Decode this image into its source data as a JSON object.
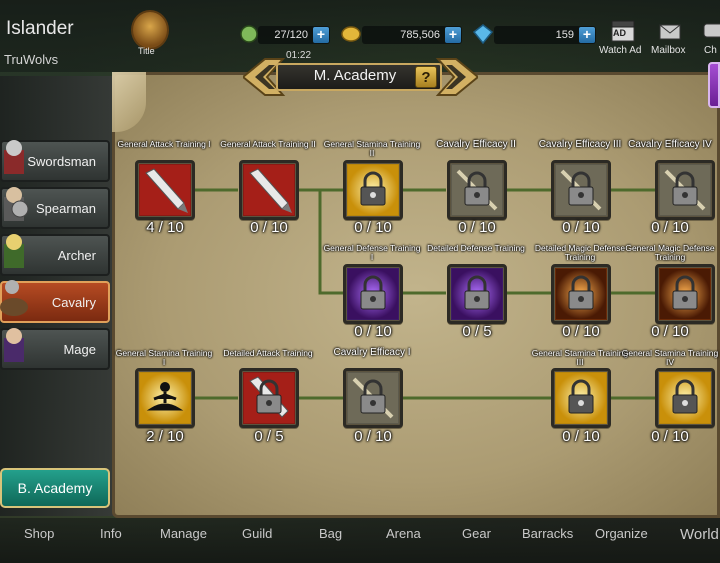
{
  "player": {
    "name": "Islander",
    "guild": "TruWolvs",
    "title_label": "Title"
  },
  "resources": [
    {
      "name": "stamina",
      "value": "27/120",
      "icon": "stamina-icon"
    },
    {
      "name": "gold",
      "value": "785,506",
      "icon": "coin-icon"
    },
    {
      "name": "gems",
      "value": "159",
      "icon": "gem-icon"
    }
  ],
  "timer": "01:22",
  "top_buttons": {
    "watch_ad": "Watch Ad",
    "watch_ad_icon_text": "AD",
    "mailbox": "Mailbox",
    "chat": "Ch"
  },
  "panel": {
    "title": "M. Academy",
    "help": "?"
  },
  "classes": [
    {
      "label": "Swordsman",
      "active": false
    },
    {
      "label": "Spearman",
      "active": false
    },
    {
      "label": "Archer",
      "active": false
    },
    {
      "label": "Cavalry",
      "active": true
    },
    {
      "label": "Mage",
      "active": false
    }
  ],
  "b_academy": "B. Academy",
  "nodes": [
    {
      "id": "n1",
      "title": "General Attack Training I",
      "level": "4 / 10",
      "icon": "sword-icon",
      "locked": false
    },
    {
      "id": "n2",
      "title": "General Attack Training II",
      "level": "0 / 10",
      "icon": "sword-icon",
      "locked": false
    },
    {
      "id": "n3",
      "title": "General Stamina Training II",
      "level": "0 / 10",
      "icon": "stamina-lock-icon",
      "locked": true
    },
    {
      "id": "n4",
      "title": "Cavalry Efficacy II",
      "level": "0 / 10",
      "icon": "lance-lock-icon",
      "locked": true
    },
    {
      "id": "n5",
      "title": "Cavalry Efficacy III",
      "level": "0 / 10",
      "icon": "lance-lock-icon",
      "locked": true
    },
    {
      "id": "n6",
      "title": "Cavalry Efficacy IV",
      "level": "0 / 10",
      "icon": "lance-lock-icon",
      "locked": true
    },
    {
      "id": "n7",
      "title": "General Defense Training I",
      "level": "0 / 10",
      "icon": "defense-lock-icon",
      "locked": true
    },
    {
      "id": "n8",
      "title": "Detailed Defense Training",
      "level": "0 / 5",
      "icon": "defense-lock-icon",
      "locked": true
    },
    {
      "id": "n9",
      "title": "Detailed Magic Defense Training",
      "level": "0 / 10",
      "icon": "magic-defense-lock-icon",
      "locked": true
    },
    {
      "id": "n10",
      "title": "General Magic Defense Training",
      "level": "0 / 10",
      "icon": "magic-defense-lock-icon",
      "locked": true
    },
    {
      "id": "n11",
      "title": "General Stamina Training I",
      "level": "2 / 10",
      "icon": "meditation-icon",
      "locked": false
    },
    {
      "id": "n12",
      "title": "Detailed Attack Training",
      "level": "0 / 5",
      "icon": "sword-lock-icon",
      "locked": true
    },
    {
      "id": "n13",
      "title": "Cavalry Efficacy I",
      "level": "0 / 10",
      "icon": "lance-lock-icon",
      "locked": true
    },
    {
      "id": "n14",
      "title": "General Stamina Training III",
      "level": "0 / 10",
      "icon": "stamina-lock-icon",
      "locked": true
    },
    {
      "id": "n15",
      "title": "General Stamina Training IV",
      "level": "0 / 10",
      "icon": "stamina-lock-icon",
      "locked": true
    }
  ],
  "nav": [
    "Shop",
    "Info",
    "Manage",
    "Guild",
    "Bag",
    "Arena",
    "Gear",
    "Barracks",
    "Organize",
    "World"
  ],
  "colors": {
    "parchment": "#b5a67d",
    "active_tab": "#a0401c",
    "b_academy": "#1a8a76",
    "link_line": "#4e6a2c",
    "gold_frame": "#c9a860"
  }
}
